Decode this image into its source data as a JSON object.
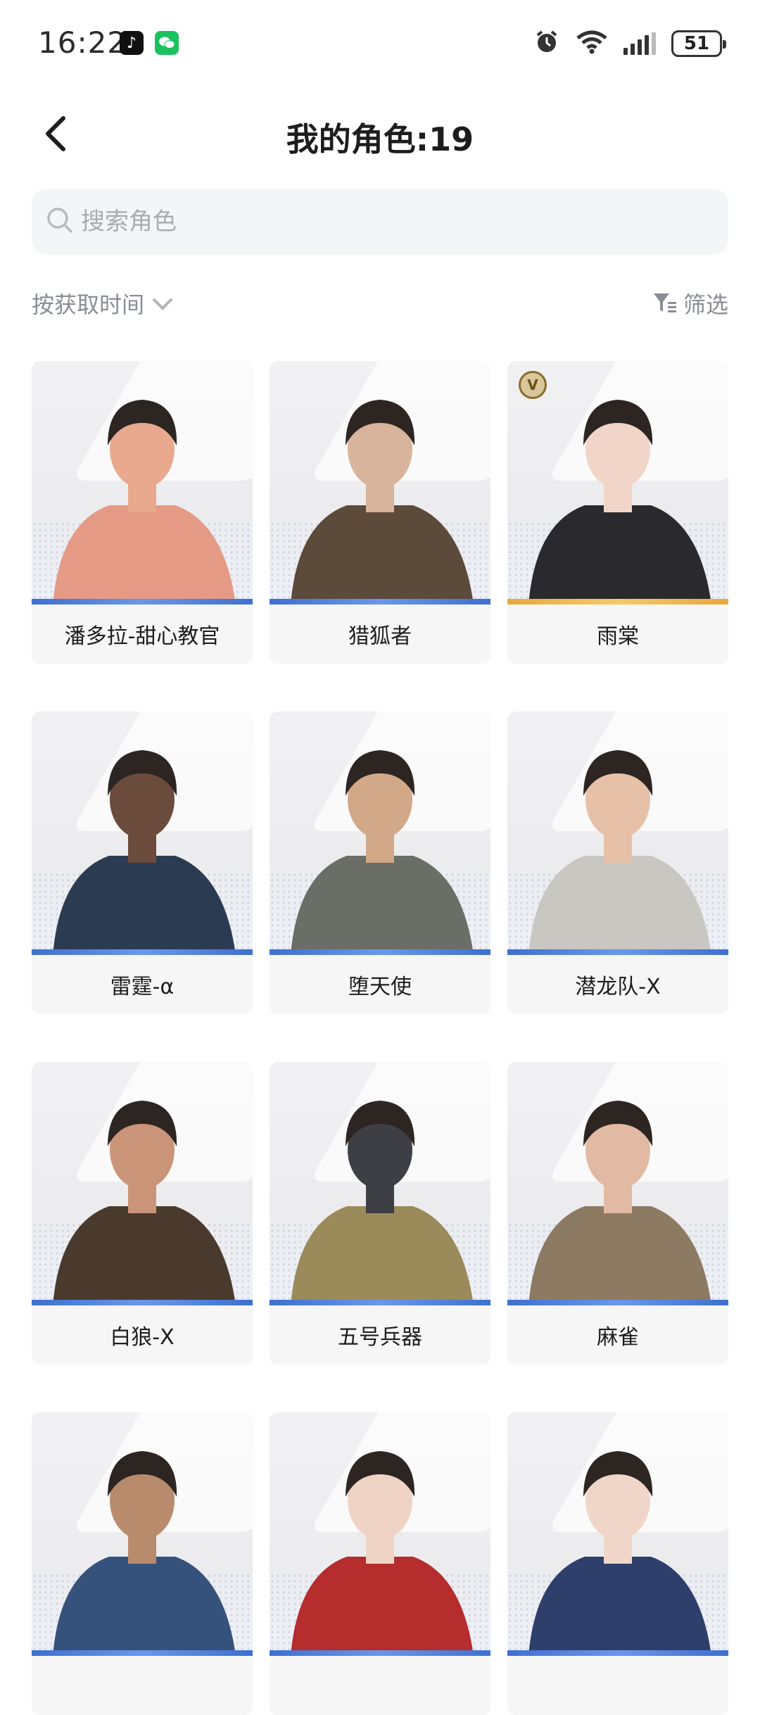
{
  "status_bar": {
    "time": "16:22",
    "battery": "51",
    "apps": [
      "tiktok-icon",
      "wechat-icon"
    ]
  },
  "header": {
    "title": "我的角色:19"
  },
  "search": {
    "placeholder": "搜索角色"
  },
  "sort": {
    "label": "按获取时间"
  },
  "filter": {
    "label": "筛选"
  },
  "characters": [
    {
      "name": "潘多拉-甜心教官",
      "bar": "blue",
      "skin": "#e9a98f",
      "outfit": "#e59a86"
    },
    {
      "name": "猎狐者",
      "bar": "blue",
      "skin": "#d7b49b",
      "outfit": "#5c4a3a"
    },
    {
      "name": "雨棠",
      "bar": "gold",
      "skin": "#f1d5c8",
      "outfit": "#2a2a2e",
      "badge": "V"
    },
    {
      "name": "雷霆-α",
      "bar": "blue",
      "skin": "#6b4b3c",
      "outfit": "#2b3b52"
    },
    {
      "name": "堕天使",
      "bar": "blue",
      "skin": "#d1a888",
      "outfit": "#6a6e66"
    },
    {
      "name": "潜龙队-X",
      "bar": "blue",
      "skin": "#e6c1a8",
      "outfit": "#c9c7c2"
    },
    {
      "name": "白狼-X",
      "bar": "blue",
      "skin": "#c99478",
      "outfit": "#4a3a2e"
    },
    {
      "name": "五号兵器",
      "bar": "blue",
      "skin": "#3d3f45",
      "outfit": "#9b8b5a"
    },
    {
      "name": "麻雀",
      "bar": "blue",
      "skin": "#e2b9a2",
      "outfit": "#8d7a63"
    },
    {
      "name": "",
      "bar": "blue",
      "skin": "#b88b6d",
      "outfit": "#35527c"
    },
    {
      "name": "",
      "bar": "blue",
      "skin": "#efd3c5",
      "outfit": "#b52d2d"
    },
    {
      "name": "",
      "bar": "blue",
      "skin": "#f0d6c8",
      "outfit": "#2e3f6c"
    }
  ],
  "colors": {
    "accent_blue": "#3f6fcf",
    "accent_gold": "#e7a93a",
    "muted_text": "#8a8d93"
  }
}
